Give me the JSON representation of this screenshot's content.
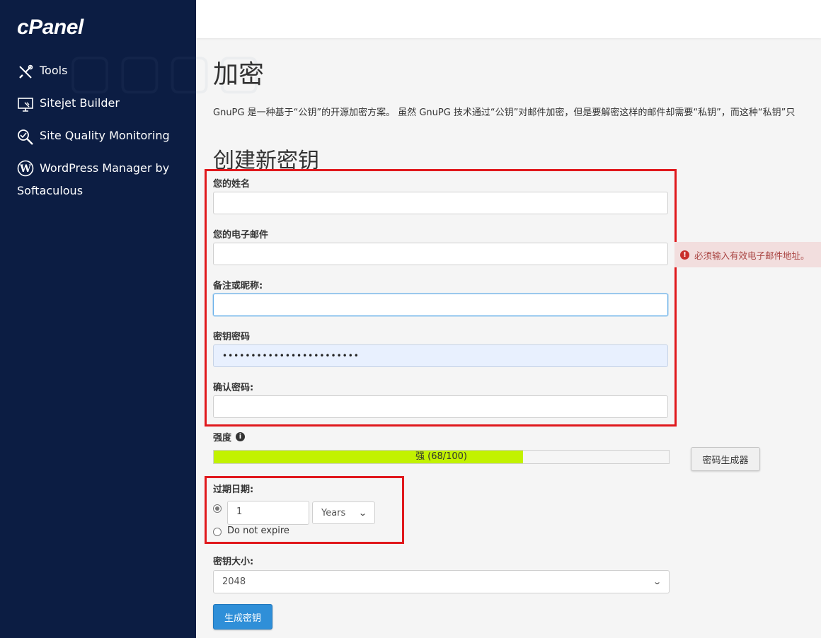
{
  "brand": {
    "logo": "cPanel"
  },
  "sidebar": {
    "items": [
      {
        "label": "Tools",
        "icon": "tools-icon"
      },
      {
        "label": "Sitejet Builder",
        "icon": "sitejet-icon"
      },
      {
        "label": "Site Quality Monitoring",
        "icon": "site-quality-icon"
      },
      {
        "label_line1": "WordPress Manager by",
        "label_line2": "Softaculous",
        "icon": "wordpress-icon"
      }
    ]
  },
  "page": {
    "title": "加密",
    "intro": "GnuPG 是一种基于“公钥”的开源加密方案。 虽然 GnuPG 技术通过“公钥”对邮件加密，但是要解密这样的邮件却需要“私钥”，而这种“私钥”只",
    "section_title": "创建新密钥"
  },
  "form": {
    "name_label": "您的姓名",
    "name_value": "",
    "email_label": "您的电子邮件",
    "email_value": "",
    "email_error": "必须输入有效电子邮件地址。",
    "comment_label": "备注或昵称:",
    "comment_value": "",
    "password_label": "密钥密码",
    "password_value": "••••••••••••••••••••••••",
    "confirm_label": "确认密码:",
    "confirm_value": "",
    "strength_label": "强度",
    "strength_text": "强 (68/100)",
    "strength_value": 68,
    "strength_max": 100,
    "generator_button": "密码生成器",
    "expire_label": "过期日期:",
    "expire_number": "1",
    "expire_unit": "Years",
    "no_expire_label": "Do not expire",
    "keysize_label": "密钥大小:",
    "keysize_value": "2048",
    "submit_button": "生成密钥"
  },
  "colors": {
    "sidebar_bg": "#0c1d43",
    "meter_fill": "#c2f200",
    "primary": "#2f8fd8",
    "error_bg": "#f2dede",
    "highlight": "#e0181c"
  }
}
